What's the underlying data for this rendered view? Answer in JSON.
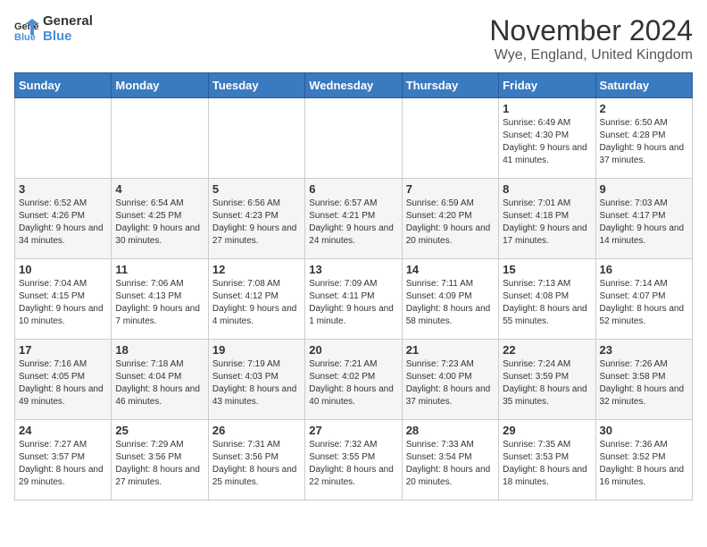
{
  "header": {
    "logo_general": "General",
    "logo_blue": "Blue",
    "month": "November 2024",
    "location": "Wye, England, United Kingdom"
  },
  "days_of_week": [
    "Sunday",
    "Monday",
    "Tuesday",
    "Wednesday",
    "Thursday",
    "Friday",
    "Saturday"
  ],
  "weeks": [
    [
      {
        "day": "",
        "info": ""
      },
      {
        "day": "",
        "info": ""
      },
      {
        "day": "",
        "info": ""
      },
      {
        "day": "",
        "info": ""
      },
      {
        "day": "",
        "info": ""
      },
      {
        "day": "1",
        "info": "Sunrise: 6:49 AM\nSunset: 4:30 PM\nDaylight: 9 hours and 41 minutes."
      },
      {
        "day": "2",
        "info": "Sunrise: 6:50 AM\nSunset: 4:28 PM\nDaylight: 9 hours and 37 minutes."
      }
    ],
    [
      {
        "day": "3",
        "info": "Sunrise: 6:52 AM\nSunset: 4:26 PM\nDaylight: 9 hours and 34 minutes."
      },
      {
        "day": "4",
        "info": "Sunrise: 6:54 AM\nSunset: 4:25 PM\nDaylight: 9 hours and 30 minutes."
      },
      {
        "day": "5",
        "info": "Sunrise: 6:56 AM\nSunset: 4:23 PM\nDaylight: 9 hours and 27 minutes."
      },
      {
        "day": "6",
        "info": "Sunrise: 6:57 AM\nSunset: 4:21 PM\nDaylight: 9 hours and 24 minutes."
      },
      {
        "day": "7",
        "info": "Sunrise: 6:59 AM\nSunset: 4:20 PM\nDaylight: 9 hours and 20 minutes."
      },
      {
        "day": "8",
        "info": "Sunrise: 7:01 AM\nSunset: 4:18 PM\nDaylight: 9 hours and 17 minutes."
      },
      {
        "day": "9",
        "info": "Sunrise: 7:03 AM\nSunset: 4:17 PM\nDaylight: 9 hours and 14 minutes."
      }
    ],
    [
      {
        "day": "10",
        "info": "Sunrise: 7:04 AM\nSunset: 4:15 PM\nDaylight: 9 hours and 10 minutes."
      },
      {
        "day": "11",
        "info": "Sunrise: 7:06 AM\nSunset: 4:13 PM\nDaylight: 9 hours and 7 minutes."
      },
      {
        "day": "12",
        "info": "Sunrise: 7:08 AM\nSunset: 4:12 PM\nDaylight: 9 hours and 4 minutes."
      },
      {
        "day": "13",
        "info": "Sunrise: 7:09 AM\nSunset: 4:11 PM\nDaylight: 9 hours and 1 minute."
      },
      {
        "day": "14",
        "info": "Sunrise: 7:11 AM\nSunset: 4:09 PM\nDaylight: 8 hours and 58 minutes."
      },
      {
        "day": "15",
        "info": "Sunrise: 7:13 AM\nSunset: 4:08 PM\nDaylight: 8 hours and 55 minutes."
      },
      {
        "day": "16",
        "info": "Sunrise: 7:14 AM\nSunset: 4:07 PM\nDaylight: 8 hours and 52 minutes."
      }
    ],
    [
      {
        "day": "17",
        "info": "Sunrise: 7:16 AM\nSunset: 4:05 PM\nDaylight: 8 hours and 49 minutes."
      },
      {
        "day": "18",
        "info": "Sunrise: 7:18 AM\nSunset: 4:04 PM\nDaylight: 8 hours and 46 minutes."
      },
      {
        "day": "19",
        "info": "Sunrise: 7:19 AM\nSunset: 4:03 PM\nDaylight: 8 hours and 43 minutes."
      },
      {
        "day": "20",
        "info": "Sunrise: 7:21 AM\nSunset: 4:02 PM\nDaylight: 8 hours and 40 minutes."
      },
      {
        "day": "21",
        "info": "Sunrise: 7:23 AM\nSunset: 4:00 PM\nDaylight: 8 hours and 37 minutes."
      },
      {
        "day": "22",
        "info": "Sunrise: 7:24 AM\nSunset: 3:59 PM\nDaylight: 8 hours and 35 minutes."
      },
      {
        "day": "23",
        "info": "Sunrise: 7:26 AM\nSunset: 3:58 PM\nDaylight: 8 hours and 32 minutes."
      }
    ],
    [
      {
        "day": "24",
        "info": "Sunrise: 7:27 AM\nSunset: 3:57 PM\nDaylight: 8 hours and 29 minutes."
      },
      {
        "day": "25",
        "info": "Sunrise: 7:29 AM\nSunset: 3:56 PM\nDaylight: 8 hours and 27 minutes."
      },
      {
        "day": "26",
        "info": "Sunrise: 7:31 AM\nSunset: 3:56 PM\nDaylight: 8 hours and 25 minutes."
      },
      {
        "day": "27",
        "info": "Sunrise: 7:32 AM\nSunset: 3:55 PM\nDaylight: 8 hours and 22 minutes."
      },
      {
        "day": "28",
        "info": "Sunrise: 7:33 AM\nSunset: 3:54 PM\nDaylight: 8 hours and 20 minutes."
      },
      {
        "day": "29",
        "info": "Sunrise: 7:35 AM\nSunset: 3:53 PM\nDaylight: 8 hours and 18 minutes."
      },
      {
        "day": "30",
        "info": "Sunrise: 7:36 AM\nSunset: 3:52 PM\nDaylight: 8 hours and 16 minutes."
      }
    ]
  ]
}
